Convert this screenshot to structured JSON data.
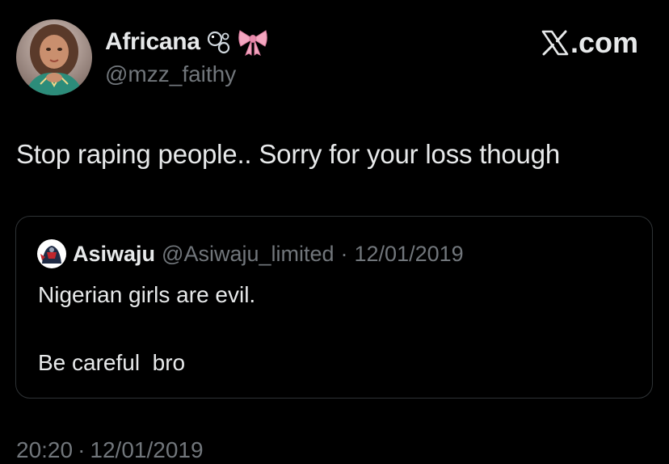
{
  "author": {
    "display_name": "Africana",
    "handle": "@mzz_faithy",
    "emojis": [
      "bubbles-emoji",
      "ribbon-emoji"
    ]
  },
  "brand": {
    "logo_text": ".com"
  },
  "tweet": {
    "text": "Stop raping people.. Sorry for your loss though"
  },
  "quote": {
    "display_name": "Asiwaju",
    "handle": "@Asiwaju_limited",
    "separator": "·",
    "date": "12/01/2019",
    "line1": "Nigerian girls are evil.",
    "line2": "Be careful  bro"
  },
  "meta": {
    "time": "20:20",
    "separator": "·",
    "date": "12/01/2019"
  },
  "colors": {
    "background": "#000000",
    "text_primary": "#e7e9ea",
    "text_secondary": "#71767b",
    "border": "#2f3336",
    "ribbon_pink": "#f4a6c0"
  }
}
